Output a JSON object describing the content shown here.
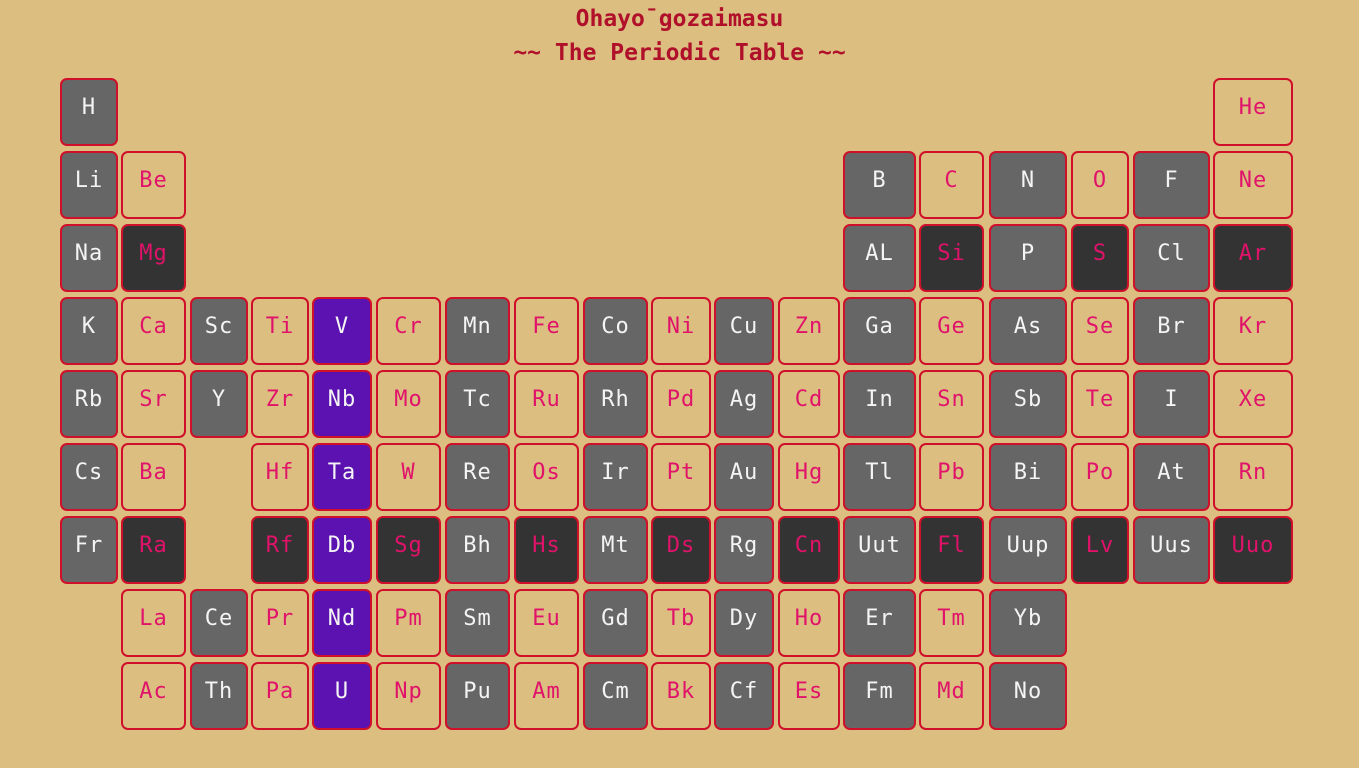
{
  "title": {
    "line1": "Ohayo¯gozaimasu",
    "line2": "~~ The Periodic Table ~~"
  },
  "colors": {
    "background": "#dcbf80",
    "border": "#d0102a",
    "gray": "#666666",
    "dark": "#333333",
    "purple": "#5b12b0",
    "light_text": "#f4f4f4",
    "pink_text": "#e0126a",
    "title_red": "#b0102a"
  },
  "elements": [
    {
      "symbol": "H",
      "row": 0,
      "col": 0,
      "style": "gray"
    },
    {
      "symbol": "He",
      "row": 0,
      "col": 17,
      "style": "tan"
    },
    {
      "symbol": "Li",
      "row": 1,
      "col": 0,
      "style": "gray"
    },
    {
      "symbol": "Be",
      "row": 1,
      "col": 1,
      "style": "tan"
    },
    {
      "symbol": "B",
      "row": 1,
      "col": 12,
      "style": "gray"
    },
    {
      "symbol": "C",
      "row": 1,
      "col": 13,
      "style": "tan"
    },
    {
      "symbol": "N",
      "row": 1,
      "col": 14,
      "style": "gray"
    },
    {
      "symbol": "O",
      "row": 1,
      "col": 15,
      "style": "tan"
    },
    {
      "symbol": "F",
      "row": 1,
      "col": 16,
      "style": "gray"
    },
    {
      "symbol": "Ne",
      "row": 1,
      "col": 17,
      "style": "tan"
    },
    {
      "symbol": "Na",
      "row": 2,
      "col": 0,
      "style": "gray"
    },
    {
      "symbol": "Mg",
      "row": 2,
      "col": 1,
      "style": "dark"
    },
    {
      "symbol": "AL",
      "row": 2,
      "col": 12,
      "style": "gray"
    },
    {
      "symbol": "Si",
      "row": 2,
      "col": 13,
      "style": "dark"
    },
    {
      "symbol": "P",
      "row": 2,
      "col": 14,
      "style": "gray"
    },
    {
      "symbol": "S",
      "row": 2,
      "col": 15,
      "style": "dark"
    },
    {
      "symbol": "Cl",
      "row": 2,
      "col": 16,
      "style": "gray"
    },
    {
      "symbol": "Ar",
      "row": 2,
      "col": 17,
      "style": "dark"
    },
    {
      "symbol": "K",
      "row": 3,
      "col": 0,
      "style": "gray"
    },
    {
      "symbol": "Ca",
      "row": 3,
      "col": 1,
      "style": "tan"
    },
    {
      "symbol": "Sc",
      "row": 3,
      "col": 2,
      "style": "gray"
    },
    {
      "symbol": "Ti",
      "row": 3,
      "col": 3,
      "style": "tan"
    },
    {
      "symbol": "V",
      "row": 3,
      "col": 4,
      "style": "purple"
    },
    {
      "symbol": "Cr",
      "row": 3,
      "col": 5,
      "style": "tan"
    },
    {
      "symbol": "Mn",
      "row": 3,
      "col": 6,
      "style": "gray"
    },
    {
      "symbol": "Fe",
      "row": 3,
      "col": 7,
      "style": "tan"
    },
    {
      "symbol": "Co",
      "row": 3,
      "col": 8,
      "style": "gray"
    },
    {
      "symbol": "Ni",
      "row": 3,
      "col": 9,
      "style": "tan"
    },
    {
      "symbol": "Cu",
      "row": 3,
      "col": 10,
      "style": "gray"
    },
    {
      "symbol": "Zn",
      "row": 3,
      "col": 11,
      "style": "tan"
    },
    {
      "symbol": "Ga",
      "row": 3,
      "col": 12,
      "style": "gray"
    },
    {
      "symbol": "Ge",
      "row": 3,
      "col": 13,
      "style": "tan"
    },
    {
      "symbol": "As",
      "row": 3,
      "col": 14,
      "style": "gray"
    },
    {
      "symbol": "Se",
      "row": 3,
      "col": 15,
      "style": "tan"
    },
    {
      "symbol": "Br",
      "row": 3,
      "col": 16,
      "style": "gray"
    },
    {
      "symbol": "Kr",
      "row": 3,
      "col": 17,
      "style": "tan"
    },
    {
      "symbol": "Rb",
      "row": 4,
      "col": 0,
      "style": "gray"
    },
    {
      "symbol": "Sr",
      "row": 4,
      "col": 1,
      "style": "tan"
    },
    {
      "symbol": "Y",
      "row": 4,
      "col": 2,
      "style": "gray"
    },
    {
      "symbol": "Zr",
      "row": 4,
      "col": 3,
      "style": "tan"
    },
    {
      "symbol": "Nb",
      "row": 4,
      "col": 4,
      "style": "purple"
    },
    {
      "symbol": "Mo",
      "row": 4,
      "col": 5,
      "style": "tan"
    },
    {
      "symbol": "Tc",
      "row": 4,
      "col": 6,
      "style": "gray"
    },
    {
      "symbol": "Ru",
      "row": 4,
      "col": 7,
      "style": "tan"
    },
    {
      "symbol": "Rh",
      "row": 4,
      "col": 8,
      "style": "gray"
    },
    {
      "symbol": "Pd",
      "row": 4,
      "col": 9,
      "style": "tan"
    },
    {
      "symbol": "Ag",
      "row": 4,
      "col": 10,
      "style": "gray"
    },
    {
      "symbol": "Cd",
      "row": 4,
      "col": 11,
      "style": "tan"
    },
    {
      "symbol": "In",
      "row": 4,
      "col": 12,
      "style": "gray"
    },
    {
      "symbol": "Sn",
      "row": 4,
      "col": 13,
      "style": "tan"
    },
    {
      "symbol": "Sb",
      "row": 4,
      "col": 14,
      "style": "gray"
    },
    {
      "symbol": "Te",
      "row": 4,
      "col": 15,
      "style": "tan"
    },
    {
      "symbol": "I",
      "row": 4,
      "col": 16,
      "style": "gray"
    },
    {
      "symbol": "Xe",
      "row": 4,
      "col": 17,
      "style": "tan"
    },
    {
      "symbol": "Cs",
      "row": 5,
      "col": 0,
      "style": "gray"
    },
    {
      "symbol": "Ba",
      "row": 5,
      "col": 1,
      "style": "tan"
    },
    {
      "symbol": "Hf",
      "row": 5,
      "col": 3,
      "style": "tan"
    },
    {
      "symbol": "Ta",
      "row": 5,
      "col": 4,
      "style": "purple"
    },
    {
      "symbol": "W",
      "row": 5,
      "col": 5,
      "style": "tan"
    },
    {
      "symbol": "Re",
      "row": 5,
      "col": 6,
      "style": "gray"
    },
    {
      "symbol": "Os",
      "row": 5,
      "col": 7,
      "style": "tan"
    },
    {
      "symbol": "Ir",
      "row": 5,
      "col": 8,
      "style": "gray"
    },
    {
      "symbol": "Pt",
      "row": 5,
      "col": 9,
      "style": "tan"
    },
    {
      "symbol": "Au",
      "row": 5,
      "col": 10,
      "style": "gray"
    },
    {
      "symbol": "Hg",
      "row": 5,
      "col": 11,
      "style": "tan"
    },
    {
      "symbol": "Tl",
      "row": 5,
      "col": 12,
      "style": "gray"
    },
    {
      "symbol": "Pb",
      "row": 5,
      "col": 13,
      "style": "tan"
    },
    {
      "symbol": "Bi",
      "row": 5,
      "col": 14,
      "style": "gray"
    },
    {
      "symbol": "Po",
      "row": 5,
      "col": 15,
      "style": "tan"
    },
    {
      "symbol": "At",
      "row": 5,
      "col": 16,
      "style": "gray"
    },
    {
      "symbol": "Rn",
      "row": 5,
      "col": 17,
      "style": "tan"
    },
    {
      "symbol": "Fr",
      "row": 6,
      "col": 0,
      "style": "gray"
    },
    {
      "symbol": "Ra",
      "row": 6,
      "col": 1,
      "style": "dark"
    },
    {
      "symbol": "Rf",
      "row": 6,
      "col": 3,
      "style": "dark"
    },
    {
      "symbol": "Db",
      "row": 6,
      "col": 4,
      "style": "purple"
    },
    {
      "symbol": "Sg",
      "row": 6,
      "col": 5,
      "style": "dark"
    },
    {
      "symbol": "Bh",
      "row": 6,
      "col": 6,
      "style": "gray"
    },
    {
      "symbol": "Hs",
      "row": 6,
      "col": 7,
      "style": "dark"
    },
    {
      "symbol": "Mt",
      "row": 6,
      "col": 8,
      "style": "gray"
    },
    {
      "symbol": "Ds",
      "row": 6,
      "col": 9,
      "style": "dark"
    },
    {
      "symbol": "Rg",
      "row": 6,
      "col": 10,
      "style": "gray"
    },
    {
      "symbol": "Cn",
      "row": 6,
      "col": 11,
      "style": "dark"
    },
    {
      "symbol": "Uut",
      "row": 6,
      "col": 12,
      "style": "gray"
    },
    {
      "symbol": "Fl",
      "row": 6,
      "col": 13,
      "style": "dark"
    },
    {
      "symbol": "Uup",
      "row": 6,
      "col": 14,
      "style": "gray"
    },
    {
      "symbol": "Lv",
      "row": 6,
      "col": 15,
      "style": "dark"
    },
    {
      "symbol": "Uus",
      "row": 6,
      "col": 16,
      "style": "gray"
    },
    {
      "symbol": "Uuo",
      "row": 6,
      "col": 17,
      "style": "dark"
    },
    {
      "symbol": "La",
      "row": 7,
      "col": 1,
      "style": "tan"
    },
    {
      "symbol": "Ce",
      "row": 7,
      "col": 2,
      "style": "gray"
    },
    {
      "symbol": "Pr",
      "row": 7,
      "col": 3,
      "style": "tan"
    },
    {
      "symbol": "Nd",
      "row": 7,
      "col": 4,
      "style": "purple"
    },
    {
      "symbol": "Pm",
      "row": 7,
      "col": 5,
      "style": "tan"
    },
    {
      "symbol": "Sm",
      "row": 7,
      "col": 6,
      "style": "gray"
    },
    {
      "symbol": "Eu",
      "row": 7,
      "col": 7,
      "style": "tan"
    },
    {
      "symbol": "Gd",
      "row": 7,
      "col": 8,
      "style": "gray"
    },
    {
      "symbol": "Tb",
      "row": 7,
      "col": 9,
      "style": "tan"
    },
    {
      "symbol": "Dy",
      "row": 7,
      "col": 10,
      "style": "gray"
    },
    {
      "symbol": "Ho",
      "row": 7,
      "col": 11,
      "style": "tan"
    },
    {
      "symbol": "Er",
      "row": 7,
      "col": 12,
      "style": "gray"
    },
    {
      "symbol": "Tm",
      "row": 7,
      "col": 13,
      "style": "tan"
    },
    {
      "symbol": "Yb",
      "row": 7,
      "col": 14,
      "style": "gray"
    },
    {
      "symbol": "Ac",
      "row": 8,
      "col": 1,
      "style": "tan"
    },
    {
      "symbol": "Th",
      "row": 8,
      "col": 2,
      "style": "gray"
    },
    {
      "symbol": "Pa",
      "row": 8,
      "col": 3,
      "style": "tan"
    },
    {
      "symbol": "U",
      "row": 8,
      "col": 4,
      "style": "purple"
    },
    {
      "symbol": "Np",
      "row": 8,
      "col": 5,
      "style": "tan"
    },
    {
      "symbol": "Pu",
      "row": 8,
      "col": 6,
      "style": "gray"
    },
    {
      "symbol": "Am",
      "row": 8,
      "col": 7,
      "style": "tan"
    },
    {
      "symbol": "Cm",
      "row": 8,
      "col": 8,
      "style": "gray"
    },
    {
      "symbol": "Bk",
      "row": 8,
      "col": 9,
      "style": "tan"
    },
    {
      "symbol": "Cf",
      "row": 8,
      "col": 10,
      "style": "gray"
    },
    {
      "symbol": "Es",
      "row": 8,
      "col": 11,
      "style": "tan"
    },
    {
      "symbol": "Fm",
      "row": 8,
      "col": 12,
      "style": "gray"
    },
    {
      "symbol": "Md",
      "row": 8,
      "col": 13,
      "style": "tan"
    },
    {
      "symbol": "No",
      "row": 8,
      "col": 14,
      "style": "gray"
    }
  ]
}
